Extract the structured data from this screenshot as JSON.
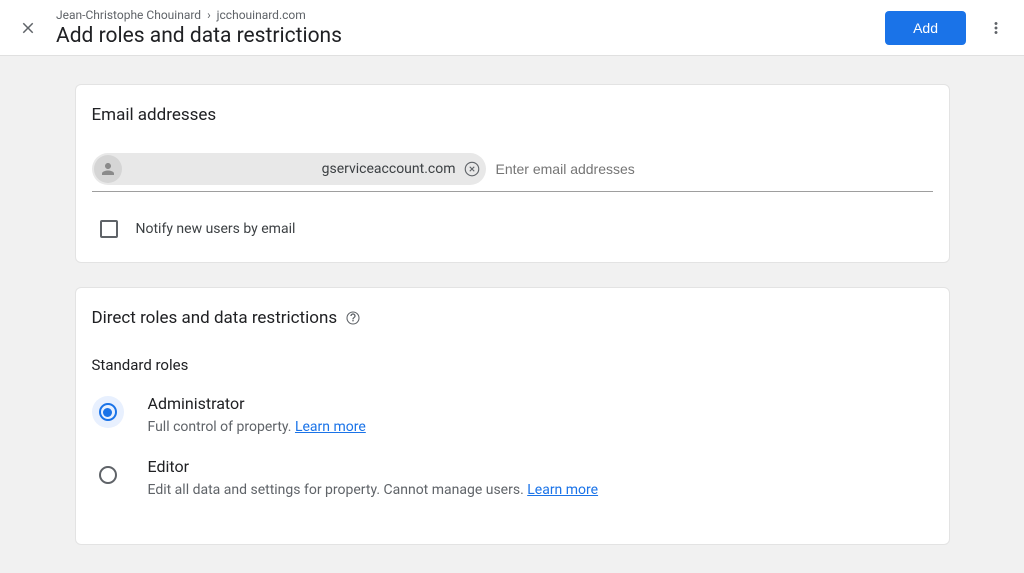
{
  "header": {
    "breadcrumb_owner": "Jean-Christophe Chouinard",
    "breadcrumb_site": "jcchouinard.com",
    "page_title": "Add roles and data restrictions",
    "add_button": "Add"
  },
  "email_section": {
    "title": "Email addresses",
    "chip_email": "gserviceaccount.com",
    "placeholder": "Enter email addresses",
    "notify_label": "Notify new users by email"
  },
  "roles_section": {
    "title": "Direct roles and data restrictions",
    "standard_heading": "Standard roles",
    "roles": [
      {
        "name": "Administrator",
        "desc": "Full control of property. ",
        "learn": "Learn more"
      },
      {
        "name": "Editor",
        "desc": "Edit all data and settings for property. Cannot manage users. ",
        "learn": "Learn more"
      }
    ]
  }
}
